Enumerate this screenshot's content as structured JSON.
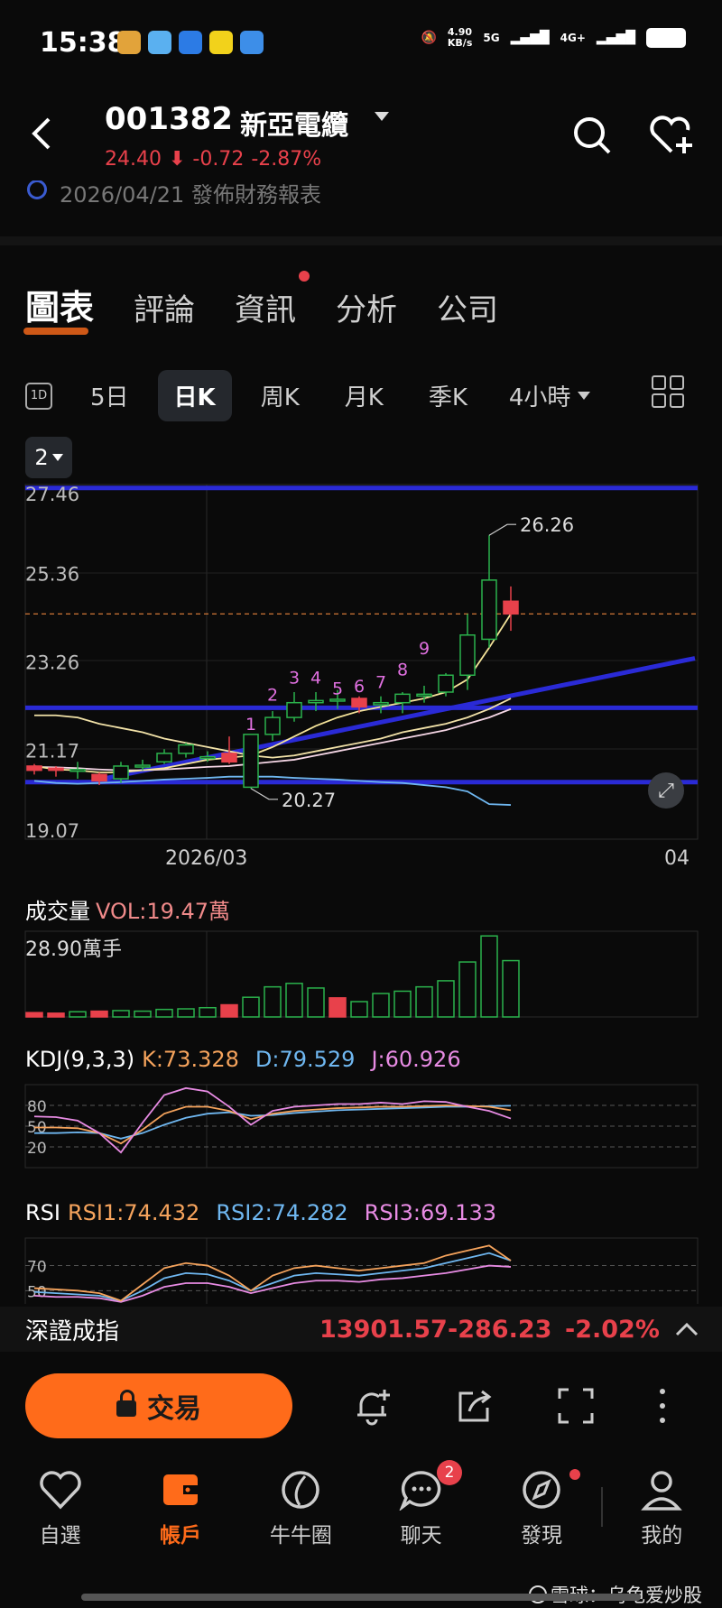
{
  "status_bar": {
    "time": "15:38",
    "net_speed": "4.90\nKB/s",
    "sig1": "5G",
    "sig2": "4G+"
  },
  "header": {
    "code": "001382",
    "name": "新亞電纜",
    "price": "24.40",
    "change": "-0.72",
    "change_pct": "-2.87%",
    "notice": "2026/04/21 發佈財務報表"
  },
  "tabs": [
    "圖表",
    "評論",
    "資訊",
    "分析",
    "公司"
  ],
  "periods": {
    "icon": "1D",
    "items": [
      "5日",
      "日K",
      "周K",
      "月K",
      "季K",
      "4小時"
    ],
    "active": 1
  },
  "chart_selector": "2",
  "colors": {
    "up": "#2bb24c",
    "down": "#e8414b",
    "accent": "#ff6b1a",
    "trendline": "#2a2ad6"
  },
  "chart_data": {
    "type": "candlestick",
    "y_ticks": [
      "27.46",
      "25.36",
      "23.26",
      "21.17",
      "19.07"
    ],
    "ylim": [
      19.07,
      27.46
    ],
    "x_ticks": [
      "2026/03",
      "04"
    ],
    "high_label": "26.26",
    "low_label": "20.27",
    "wave_labels": [
      "1",
      "2",
      "3",
      "4",
      "5",
      "6",
      "7",
      "8",
      "9"
    ],
    "candles": [
      {
        "o": 20.8,
        "c": 20.7,
        "h": 20.85,
        "l": 20.6
      },
      {
        "o": 20.75,
        "c": 20.7,
        "h": 20.8,
        "l": 20.55
      },
      {
        "o": 20.7,
        "c": 20.72,
        "h": 20.9,
        "l": 20.5
      },
      {
        "o": 20.6,
        "c": 20.45,
        "h": 20.65,
        "l": 20.35
      },
      {
        "o": 20.5,
        "c": 20.8,
        "h": 20.9,
        "l": 20.4
      },
      {
        "o": 20.8,
        "c": 20.82,
        "h": 20.95,
        "l": 20.7
      },
      {
        "o": 20.9,
        "c": 21.1,
        "h": 21.2,
        "l": 20.85
      },
      {
        "o": 21.1,
        "c": 21.3,
        "h": 21.35,
        "l": 21.0
      },
      {
        "o": 21.0,
        "c": 21.02,
        "h": 21.15,
        "l": 20.9
      },
      {
        "o": 21.1,
        "c": 20.9,
        "h": 21.5,
        "l": 20.85
      },
      {
        "o": 20.3,
        "c": 21.55,
        "h": 21.55,
        "l": 20.27
      },
      {
        "o": 21.55,
        "c": 21.95,
        "h": 22.1,
        "l": 21.4
      },
      {
        "o": 21.95,
        "c": 22.3,
        "h": 22.55,
        "l": 21.85
      },
      {
        "o": 22.3,
        "c": 22.35,
        "h": 22.55,
        "l": 22.1
      },
      {
        "o": 22.35,
        "c": 22.38,
        "h": 22.6,
        "l": 22.15
      },
      {
        "o": 22.4,
        "c": 22.2,
        "h": 22.45,
        "l": 22.05
      },
      {
        "o": 22.25,
        "c": 22.3,
        "h": 22.45,
        "l": 22.05
      },
      {
        "o": 22.3,
        "c": 22.5,
        "h": 22.55,
        "l": 22.05
      },
      {
        "o": 22.5,
        "c": 22.5,
        "h": 22.7,
        "l": 22.3
      },
      {
        "o": 22.55,
        "c": 22.95,
        "h": 23.0,
        "l": 22.45
      },
      {
        "o": 22.95,
        "c": 23.9,
        "h": 24.4,
        "l": 22.6
      },
      {
        "o": 23.8,
        "c": 25.2,
        "h": 26.26,
        "l": 23.6
      },
      {
        "o": 24.7,
        "c": 24.4,
        "h": 25.05,
        "l": 24.0
      }
    ],
    "ma_short": [
      20.8,
      20.72,
      20.7,
      20.65,
      20.65,
      20.7,
      20.75,
      20.85,
      20.95,
      21.0,
      21.05,
      21.25,
      21.5,
      21.75,
      21.95,
      22.1,
      22.2,
      22.3,
      22.4,
      22.55,
      22.85,
      23.6,
      24.4
    ],
    "ma_mid": [
      22.0,
      22.0,
      21.95,
      21.8,
      21.7,
      21.6,
      21.45,
      21.35,
      21.25,
      21.15,
      21.05,
      21.0,
      21.05,
      21.15,
      21.25,
      21.35,
      21.45,
      21.6,
      21.7,
      21.8,
      21.95,
      22.15,
      22.4
    ],
    "ma_long": [
      20.78,
      20.77,
      20.75,
      20.72,
      20.7,
      20.7,
      20.72,
      20.75,
      20.78,
      20.8,
      20.85,
      20.9,
      20.95,
      21.05,
      21.15,
      21.25,
      21.35,
      21.45,
      21.55,
      21.65,
      21.8,
      21.95,
      22.15
    ],
    "lower_band": [
      20.45,
      20.4,
      20.38,
      20.4,
      20.42,
      20.45,
      20.48,
      20.5,
      20.52,
      20.55,
      20.55,
      20.55,
      20.52,
      20.5,
      20.48,
      20.45,
      20.42,
      20.4,
      20.35,
      20.3,
      20.2,
      19.9,
      19.88
    ],
    "h_lines": [
      27.38,
      22.18,
      20.42
    ],
    "trendline": [
      [
        3,
        20.48
      ],
      [
        30.5,
        23.35
      ]
    ]
  },
  "volume": {
    "title": "成交量",
    "vol_label": "VOL:19.47萬",
    "max_label": "28.90萬手",
    "values": [
      1.5,
      1.3,
      1.8,
      2.0,
      2.2,
      2.0,
      2.6,
      2.8,
      3.2,
      4.2,
      6.8,
      10.4,
      11.6,
      10.0,
      6.6,
      5.3,
      8.1,
      8.9,
      10.4,
      12.5,
      19.0,
      28.0,
      19.47
    ],
    "up": [
      false,
      false,
      true,
      false,
      true,
      true,
      true,
      true,
      true,
      false,
      true,
      true,
      true,
      true,
      false,
      true,
      true,
      true,
      true,
      true,
      true,
      true,
      true
    ],
    "max": 29
  },
  "kdj": {
    "title": "KDJ(9,3,3)",
    "k": "K:73.328",
    "d": "D:79.529",
    "j": "J:60.926",
    "levels": [
      "80",
      "50",
      "20"
    ],
    "k_values": [
      48,
      48,
      47,
      40,
      25,
      45,
      68,
      78,
      78,
      72,
      60,
      68,
      72,
      74,
      76,
      77,
      78,
      78,
      79,
      80,
      79,
      78,
      73
    ],
    "d_values": [
      40,
      40,
      41,
      40,
      32,
      40,
      52,
      62,
      68,
      70,
      65,
      66,
      69,
      71,
      73,
      74,
      75,
      76,
      77,
      78,
      78,
      79,
      79.5
    ],
    "j_values": [
      64,
      63,
      58,
      40,
      12,
      55,
      95,
      105,
      100,
      78,
      52,
      72,
      78,
      80,
      82,
      82,
      84,
      82,
      86,
      85,
      78,
      72,
      61
    ]
  },
  "rsi": {
    "title": "RSI",
    "r1": "RSI1:74.432",
    "r2": "RSI2:74.282",
    "r3": "RSI3:69.133",
    "levels": [
      "70",
      "50"
    ],
    "r1_values": [
      52,
      51,
      50,
      48,
      42,
      55,
      68,
      72,
      70,
      62,
      50,
      62,
      68,
      70,
      68,
      66,
      68,
      70,
      72,
      78,
      82,
      86,
      74
    ],
    "r2_values": [
      49,
      48,
      47,
      46,
      42,
      50,
      60,
      64,
      63,
      58,
      50,
      56,
      62,
      64,
      63,
      62,
      64,
      66,
      68,
      72,
      76,
      80,
      74
    ],
    "r3_values": [
      46,
      45,
      45,
      44,
      41,
      46,
      53,
      56,
      56,
      53,
      48,
      52,
      56,
      58,
      58,
      57,
      59,
      60,
      62,
      64,
      67,
      70,
      69
    ]
  },
  "index_bar": {
    "name": "深證成指",
    "value": "13901.57",
    "change": "-286.23",
    "pct": "-2.02%"
  },
  "trade_button": "交易",
  "nav": [
    {
      "label": "自選"
    },
    {
      "label": "帳戶"
    },
    {
      "label": "牛牛圈"
    },
    {
      "label": "聊天",
      "badge": "2"
    },
    {
      "label": "發現"
    },
    {
      "label": "我的"
    }
  ],
  "watermark": "雪球：乌龟爱炒股"
}
